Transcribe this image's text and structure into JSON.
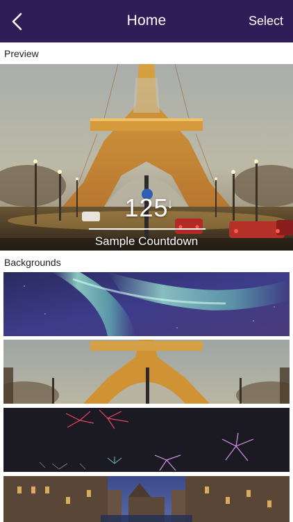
{
  "nav": {
    "title": "Home",
    "select_label": "Select",
    "back_icon": "chevron-left-icon"
  },
  "sections": {
    "preview_label": "Preview",
    "backgrounds_label": "Backgrounds"
  },
  "preview": {
    "countdown_value": "125",
    "countdown_arrow": "↓",
    "countdown_label": "Sample Countdown"
  },
  "backgrounds": [
    {
      "name": "aurora"
    },
    {
      "name": "eiffel-tower"
    },
    {
      "name": "fireworks"
    },
    {
      "name": "canal-city"
    }
  ],
  "colors": {
    "nav_background": "#2f1d58",
    "nav_text": "#ffffff",
    "label_text": "#1f1f1f",
    "page_background": "#ffffff"
  }
}
